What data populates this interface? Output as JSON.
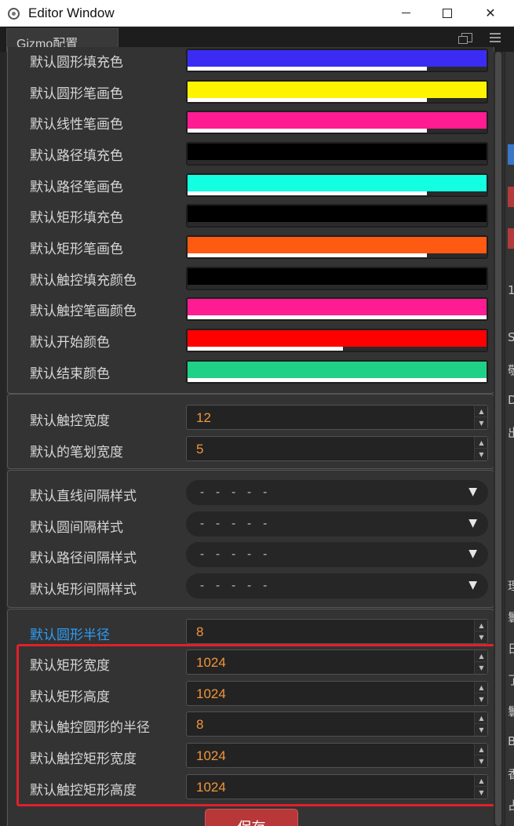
{
  "window": {
    "title": "Editor Window",
    "controls": {
      "minimize": "",
      "maximize": "",
      "close": "✕"
    }
  },
  "tab": {
    "label": "Gizmo配置"
  },
  "colors": [
    {
      "label": "默认圆形填充色",
      "color": "#3b2cf3",
      "alpha": 0.8
    },
    {
      "label": "默认圆形笔画色",
      "color": "#fff400",
      "alpha": 0.8
    },
    {
      "label": "默认线性笔画色",
      "color": "#ff1b91",
      "alpha": 0.8
    },
    {
      "label": "默认路径填充色",
      "color": "#000000",
      "alpha": 0.0
    },
    {
      "label": "默认路径笔画色",
      "color": "#12ffe2",
      "alpha": 0.8
    },
    {
      "label": "默认矩形填充色",
      "color": "#000000",
      "alpha": 0.0
    },
    {
      "label": "默认矩形笔画色",
      "color": "#ff5a12",
      "alpha": 0.8
    },
    {
      "label": "默认触控填充颜色",
      "color": "#000000",
      "alpha": 0.0
    },
    {
      "label": "默认触控笔画颜色",
      "color": "#ff1b91",
      "alpha": 1.0
    },
    {
      "label": "默认开始颜色",
      "color": "#ff0000",
      "alpha": 0.52
    },
    {
      "label": "默认结束颜色",
      "color": "#1ed187",
      "alpha": 1.0
    }
  ],
  "widths": [
    {
      "label": "默认触控宽度",
      "value": "12"
    },
    {
      "label": "默认的笔划宽度",
      "value": "5"
    }
  ],
  "dashes": [
    {
      "label": "默认直线间隔样式",
      "value": "- - - - -"
    },
    {
      "label": "默认圆间隔样式",
      "value": "- - - - -"
    },
    {
      "label": "默认路径间隔样式",
      "value": "- - - - -"
    },
    {
      "label": "默认矩形间隔样式",
      "value": "- - - - -"
    }
  ],
  "sizes": [
    {
      "label": "默认圆形半径",
      "value": "8"
    },
    {
      "label": "默认矩形宽度",
      "value": "1024"
    },
    {
      "label": "默认矩形高度",
      "value": "1024"
    },
    {
      "label": "默认触控圆形的半径",
      "value": "8"
    },
    {
      "label": "默认触控矩形宽度",
      "value": "1024"
    },
    {
      "label": "默认触控矩形高度",
      "value": "1024"
    }
  ],
  "dropdown_icon": "▼",
  "spinner": {
    "up": "▲",
    "down": "▼"
  },
  "save_button": {
    "label": "保存"
  },
  "right_panel": {
    "fragments": [
      "1",
      "Sc",
      "敬",
      "D",
      "出",
      "理",
      "鬟",
      "日",
      "了",
      "鬟",
      "B",
      "香",
      "占"
    ],
    "block_colors": [
      "#3a77c9",
      "#b23a3a",
      "#b23a3a"
    ]
  }
}
